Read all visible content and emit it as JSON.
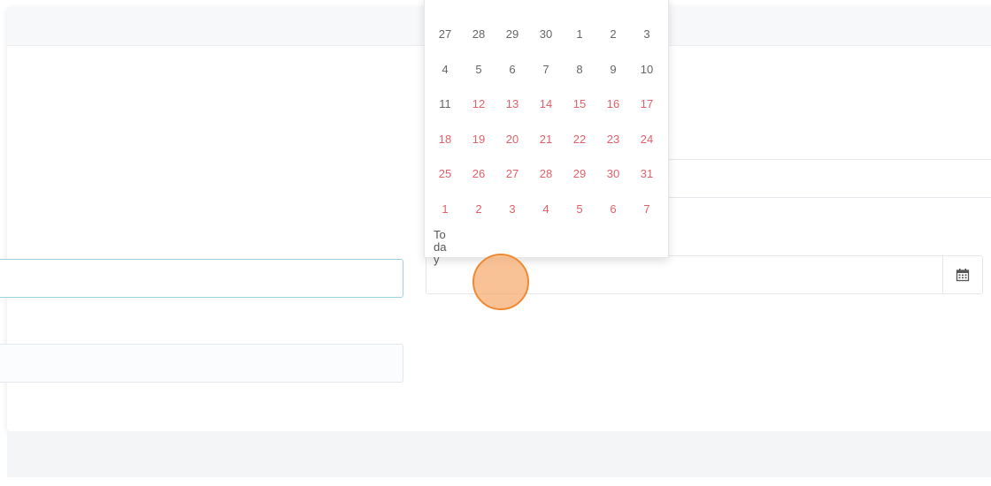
{
  "datepicker": {
    "days": [
      {
        "label": "27",
        "red": false
      },
      {
        "label": "28",
        "red": false
      },
      {
        "label": "29",
        "red": false
      },
      {
        "label": "30",
        "red": false
      },
      {
        "label": "1",
        "red": false
      },
      {
        "label": "2",
        "red": false
      },
      {
        "label": "3",
        "red": false
      },
      {
        "label": "4",
        "red": false
      },
      {
        "label": "5",
        "red": false
      },
      {
        "label": "6",
        "red": false
      },
      {
        "label": "7",
        "red": false
      },
      {
        "label": "8",
        "red": false
      },
      {
        "label": "9",
        "red": false
      },
      {
        "label": "10",
        "red": false
      },
      {
        "label": "11",
        "red": false
      },
      {
        "label": "12",
        "red": true
      },
      {
        "label": "13",
        "red": true
      },
      {
        "label": "14",
        "red": true
      },
      {
        "label": "15",
        "red": true
      },
      {
        "label": "16",
        "red": true
      },
      {
        "label": "17",
        "red": true
      },
      {
        "label": "18",
        "red": true
      },
      {
        "label": "19",
        "red": true
      },
      {
        "label": "20",
        "red": true
      },
      {
        "label": "21",
        "red": true
      },
      {
        "label": "22",
        "red": true
      },
      {
        "label": "23",
        "red": true
      },
      {
        "label": "24",
        "red": true
      },
      {
        "label": "25",
        "red": true
      },
      {
        "label": "26",
        "red": true
      },
      {
        "label": "27",
        "red": true
      },
      {
        "label": "28",
        "red": true
      },
      {
        "label": "29",
        "red": true
      },
      {
        "label": "30",
        "red": true
      },
      {
        "label": "31",
        "red": true
      },
      {
        "label": "1",
        "red": true
      },
      {
        "label": "2",
        "red": true
      },
      {
        "label": "3",
        "red": true
      },
      {
        "label": "4",
        "red": true
      },
      {
        "label": "5",
        "red": true
      },
      {
        "label": "6",
        "red": true
      },
      {
        "label": "7",
        "red": true
      }
    ],
    "today_label": "Today"
  },
  "date_field": {
    "value": "",
    "calendar_icon": "calendar-icon"
  },
  "colors": {
    "highlighted_day": "#e0606a",
    "normal_day": "#666666",
    "focus_border": "#9ed0e6",
    "click_indicator": "#f08a32"
  }
}
